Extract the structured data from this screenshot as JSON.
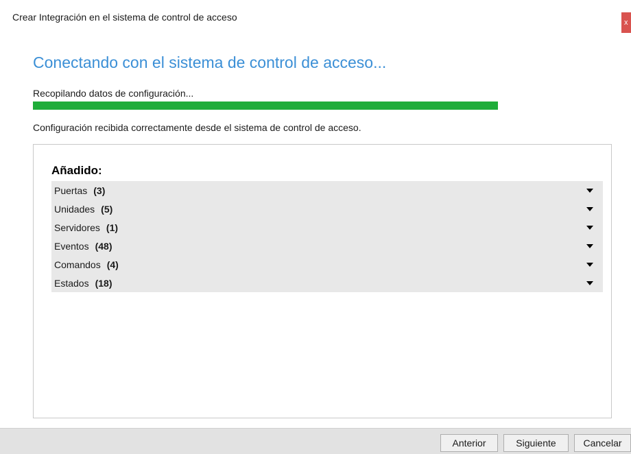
{
  "window": {
    "title": "Crear Integración en el sistema de control de acceso",
    "close_label": "x"
  },
  "heading": "Conectando con el sistema de control de acceso...",
  "status": "Recopilando datos de configuración...",
  "progress": {
    "value": 1.0,
    "color": "#1fad3a"
  },
  "success_message": "Configuración recibida correctamente desde el sistema de control de acceso.",
  "panel": {
    "title": "Añadido:",
    "items": [
      {
        "label": "Puertas",
        "count": "(3)"
      },
      {
        "label": "Unidades",
        "count": "(5)"
      },
      {
        "label": "Servidores",
        "count": "(1)"
      },
      {
        "label": "Eventos",
        "count": "(48)"
      },
      {
        "label": "Comandos",
        "count": "(4)"
      },
      {
        "label": "Estados",
        "count": "(18)"
      }
    ]
  },
  "footer": {
    "prev_label": "Anterior",
    "next_label": "Siguiente",
    "cancel_label": "Cancelar"
  },
  "icons": {
    "expand": "chevron-down-icon",
    "close": "close-icon"
  },
  "colors": {
    "heading": "#3b8fd6",
    "close": "#d9534f"
  }
}
